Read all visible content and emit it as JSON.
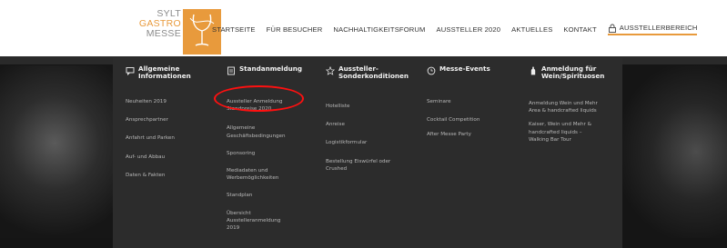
{
  "logo": {
    "line1": "SYLT",
    "line2": "GASTRO",
    "line3": "MESSE",
    "brand_color": "#e89a3c"
  },
  "nav": {
    "items": [
      "STARTSEITE",
      "FÜR BESUCHER",
      "NACHHALTIGKEITSFORUM",
      "AUSSTELLER 2020",
      "AKTUELLES",
      "KONTAKT"
    ],
    "exhibitor_area": "AUSSTELLERBEREICH",
    "exhibitor_icon": "lock-icon"
  },
  "menu": {
    "columns": [
      {
        "title_line1": "Allgemeine",
        "title_line2": "Informationen",
        "icon": "chat-icon",
        "items": [
          "Neuheiten 2019",
          "Ansprechpartner",
          "Anfahrt und Parken",
          "Auf- und Abbau",
          "Daten & Fakten"
        ]
      },
      {
        "title_line1": "Standanmeldung",
        "title_line2": "",
        "icon": "document-icon",
        "items": [
          "Aussteller Anmeldung",
          "Standpreise 2020",
          "Allgemeine Geschäftsbedingungen",
          "Sponsoring",
          "Mediadaten und Werbemöglichkeiten",
          "Standplan",
          "Übersicht Ausstelleranmeldung 2019"
        ]
      },
      {
        "title_line1": "Aussteller-",
        "title_line2": "Sonderkonditionen",
        "icon": "star-icon",
        "items": [
          "Hotelliste",
          "Anreise",
          "Logistikformular",
          "Bestellung Eiswürfel oder Crushed"
        ]
      },
      {
        "title_line1": "Messe-Events",
        "title_line2": "",
        "icon": "clock-icon",
        "items": [
          "Seminare",
          "Cocktail Competition",
          "After Messe Party"
        ]
      },
      {
        "title_line1": "Anmeldung für",
        "title_line2": "Wein/Spirituosen",
        "icon": "bottle-icon",
        "items": [
          "Anmeldung Wein und Mehr Area & handcrafted liquids",
          "Kaiser, Wein und Mehr & handcrafted liquids – Walking Bar Tour"
        ]
      }
    ],
    "highlight_color": "#ff1010"
  }
}
